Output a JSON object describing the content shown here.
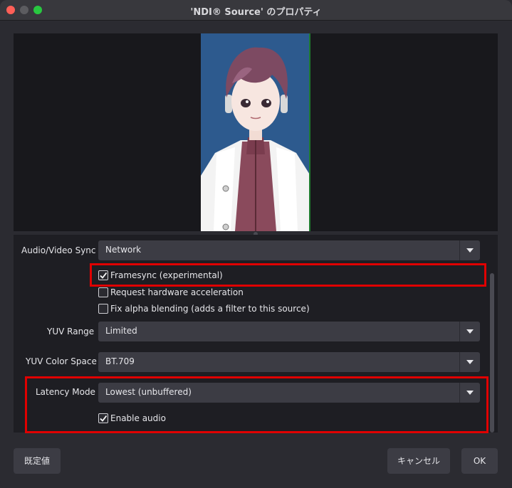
{
  "window": {
    "title": "'NDI® Source' のプロパティ"
  },
  "form": {
    "av_sync": {
      "label": "Audio/Video Sync",
      "value": "Network"
    },
    "framesync": {
      "label": "Framesync (experimental)",
      "checked": true
    },
    "hw_accel": {
      "label": "Request hardware acceleration",
      "checked": false
    },
    "fix_alpha": {
      "label": "Fix alpha blending (adds a filter to this source)",
      "checked": false
    },
    "yuv_range": {
      "label": "YUV Range",
      "value": "Limited"
    },
    "yuv_color_space": {
      "label": "YUV Color Space",
      "value": "BT.709"
    },
    "latency_mode": {
      "label": "Latency Mode",
      "value": "Lowest (unbuffered)"
    },
    "enable_audio": {
      "label": "Enable audio",
      "checked": true
    }
  },
  "buttons": {
    "defaults": "既定値",
    "cancel": "キャンセル",
    "ok": "OK"
  },
  "colors": {
    "highlight": "#e00000",
    "avatar_bg": "#2d5a8e"
  }
}
